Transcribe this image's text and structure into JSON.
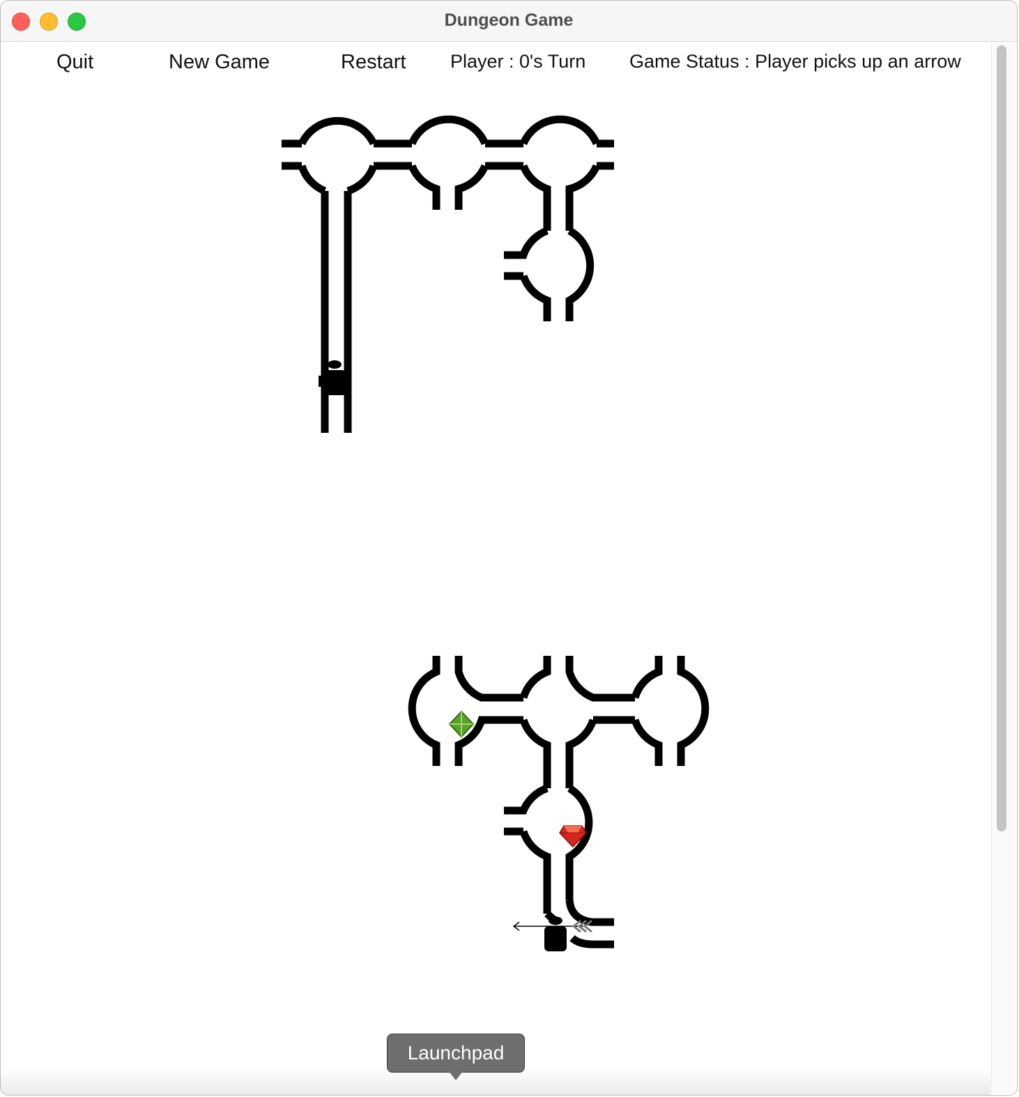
{
  "window": {
    "title": "Dungeon Game"
  },
  "menu": {
    "quit": "Quit",
    "new_game": "New Game",
    "restart": "Restart"
  },
  "player": {
    "turn_text": "Player : 0's Turn"
  },
  "status": {
    "text": "Game Status : Player picks up an arrow"
  },
  "dock": {
    "tooltip": "Launchpad"
  },
  "colors": {
    "wall": "#000000",
    "emerald": "#5aa02c",
    "ruby": "#d8261c",
    "close": "#ff5f57",
    "minimize": "#febc2e",
    "maximize": "#28c840"
  },
  "icons": [
    "player-token-icon",
    "emerald-icon",
    "ruby-icon",
    "arrow-icon"
  ]
}
